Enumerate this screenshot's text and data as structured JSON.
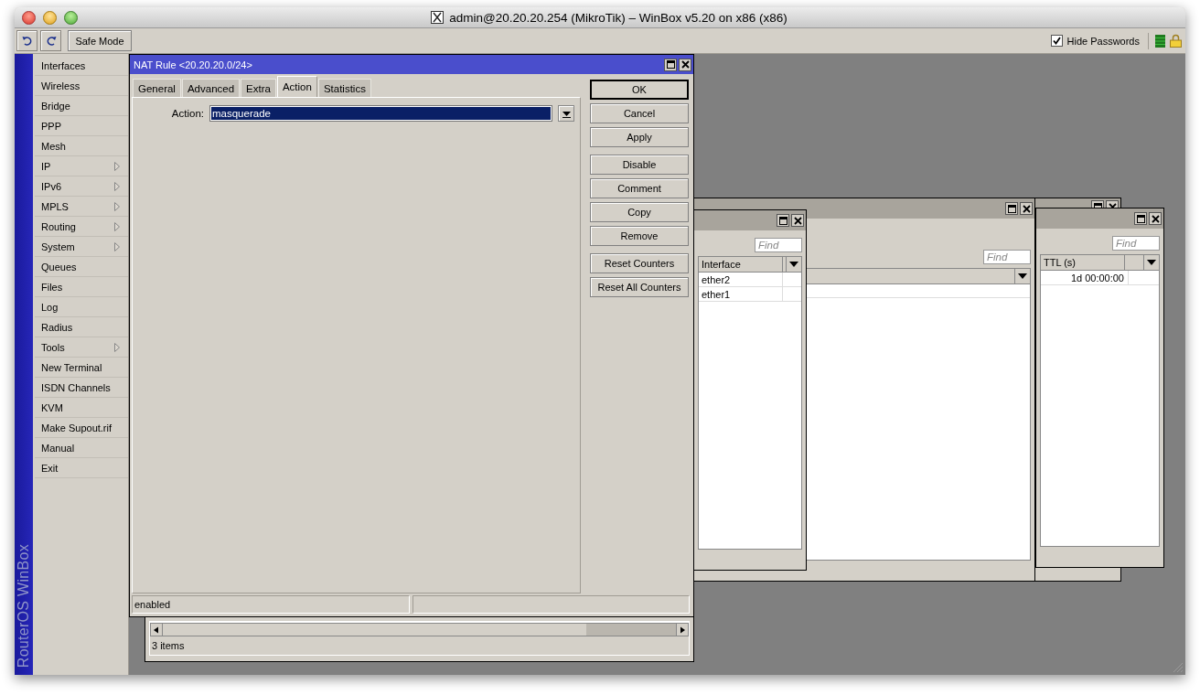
{
  "window": {
    "title": "admin@20.20.20.254 (MikroTik) – WinBox v5.20 on x86 (x86)"
  },
  "toolbar": {
    "safe_mode": "Safe Mode",
    "hide_passwords": {
      "label": "Hide Passwords",
      "checked": true
    }
  },
  "sidebar": {
    "brand": "RouterOS WinBox",
    "items": [
      {
        "label": "Interfaces",
        "submenu": false
      },
      {
        "label": "Wireless",
        "submenu": false
      },
      {
        "label": "Bridge",
        "submenu": false
      },
      {
        "label": "PPP",
        "submenu": false
      },
      {
        "label": "Mesh",
        "submenu": false
      },
      {
        "label": "IP",
        "submenu": true
      },
      {
        "label": "IPv6",
        "submenu": true
      },
      {
        "label": "MPLS",
        "submenu": true
      },
      {
        "label": "Routing",
        "submenu": true
      },
      {
        "label": "System",
        "submenu": true
      },
      {
        "label": "Queues",
        "submenu": false
      },
      {
        "label": "Files",
        "submenu": false
      },
      {
        "label": "Log",
        "submenu": false
      },
      {
        "label": "Radius",
        "submenu": false
      },
      {
        "label": "Tools",
        "submenu": true
      },
      {
        "label": "New Terminal",
        "submenu": false
      },
      {
        "label": "ISDN Channels",
        "submenu": false
      },
      {
        "label": "KVM",
        "submenu": false
      },
      {
        "label": "Make Supout.rif",
        "submenu": false
      },
      {
        "label": "Manual",
        "submenu": false
      },
      {
        "label": "Exit",
        "submenu": false
      }
    ]
  },
  "nat_rule": {
    "title": "NAT Rule <20.20.20.0/24>",
    "tabs": [
      {
        "label": "General",
        "selected": false
      },
      {
        "label": "Advanced",
        "selected": false
      },
      {
        "label": "Extra",
        "selected": false
      },
      {
        "label": "Action",
        "selected": true
      },
      {
        "label": "Statistics",
        "selected": false
      }
    ],
    "fields": [
      {
        "label": "Action:",
        "value": "masquerade"
      }
    ],
    "button_groups": [
      [
        {
          "label": "OK",
          "default": true
        },
        {
          "label": "Cancel",
          "default": false
        },
        {
          "label": "Apply",
          "default": false
        }
      ],
      [
        {
          "label": "Disable",
          "default": false
        },
        {
          "label": "Comment",
          "default": false
        },
        {
          "label": "Copy",
          "default": false
        },
        {
          "label": "Remove",
          "default": false
        }
      ],
      [
        {
          "label": "Reset Counters",
          "default": false
        },
        {
          "label": "Reset All Counters",
          "default": false
        }
      ]
    ],
    "status": "enabled"
  },
  "rules_window": {
    "status": "3 items"
  },
  "background_windows": [
    {
      "kind": "empty"
    },
    {
      "kind": "list",
      "find_placeholder": "Find"
    },
    {
      "kind": "list",
      "find_placeholder": "Find",
      "columns": [
        "Interface"
      ],
      "rows": [
        "ether2",
        "ether1"
      ]
    },
    {
      "kind": "list",
      "find_placeholder": "Find",
      "columns": [
        "TTL (s)"
      ],
      "rows": [
        "1d 00:00:00"
      ]
    }
  ]
}
